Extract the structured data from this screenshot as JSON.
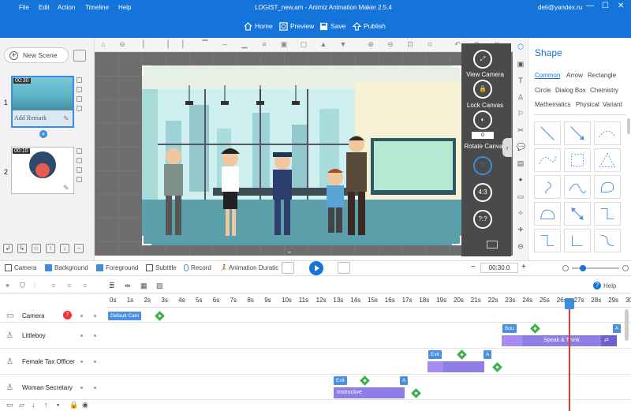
{
  "menu": [
    "File",
    "Edit",
    "Action",
    "Timeline",
    "Help"
  ],
  "window_title": "LOGIST_new.am - Animiz Animation Maker 2.5.4",
  "user_email": "deti@yandex.ru",
  "window_controls": {
    "minimize": "—",
    "maximize": "☐",
    "close": "✕"
  },
  "toolbar": {
    "home": "Home",
    "preview": "Preview",
    "save": "Save",
    "publish": "Publish"
  },
  "left": {
    "new_scene": "New Scene",
    "scenes": [
      {
        "number": "1",
        "time": "00:30",
        "remark": "Add Remark"
      },
      {
        "number": "2",
        "time": "00:10"
      }
    ],
    "add_scene": "+"
  },
  "canvas": {
    "camera_label": "Default Camera",
    "view_camera": "View Camera",
    "lock_canvas": "Lock Canvas",
    "rotate_value": "0",
    "rotate_canvas": "Rotate Canvas",
    "ratio": "4:3",
    "ratio_custom": "?:?"
  },
  "right": {
    "title": "Shape",
    "categories": [
      "Common",
      "Arrow",
      "Rectangle",
      "Circle",
      "Dialog Box",
      "Chemistry",
      "Mathematics",
      "Physical",
      "Variant"
    ]
  },
  "midbar": {
    "camera": "Camera",
    "background": "Background",
    "foreground": "Foreground",
    "subtitle": "Subtitle",
    "record": "Record",
    "anim_duration": "Animation Duratic",
    "time": "00:30.0",
    "minus": "−",
    "plus": "+",
    "help": "Help"
  },
  "timeline": {
    "ticks": [
      "0s",
      "1s",
      "2s",
      "3s",
      "4s",
      "5s",
      "6s",
      "7s",
      "8s",
      "9s",
      "10s",
      "11s",
      "12s",
      "13s",
      "14s",
      "15s",
      "16s",
      "17s",
      "18s",
      "19s",
      "20s",
      "21s",
      "22s",
      "23s",
      "24s",
      "25s",
      "26s",
      "27s",
      "28s",
      "29s",
      "30s"
    ],
    "playhead_time_s": 26.5,
    "rows": [
      {
        "name": "Camera",
        "badge": "7",
        "tag": "Default Cam"
      },
      {
        "name": "Littleboy",
        "tag": "Bou",
        "bar": "Speak & Think",
        "a": "A"
      },
      {
        "name": "Female Tax Officer",
        "tag": "Exit",
        "a": "A"
      },
      {
        "name": "Woman Secretary",
        "tag": "Exit",
        "bar": "Instructive",
        "a": "A"
      }
    ]
  },
  "colors": {
    "accent": "#1474d9",
    "bar": "#8f7ee6",
    "keyframe": "#3dae4a",
    "playhead": "#e33333"
  }
}
